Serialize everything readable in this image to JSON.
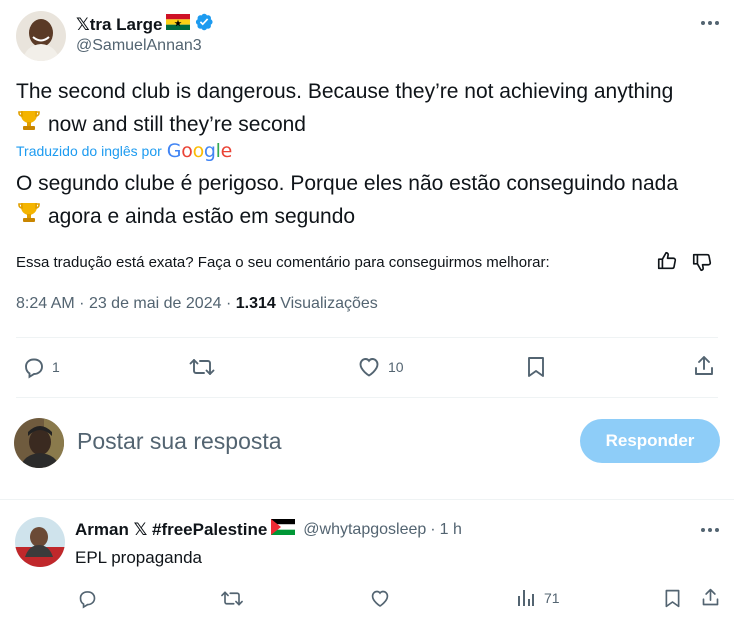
{
  "tweet": {
    "author_name": "𝕏tra Large",
    "author_handle": "@SamuelAnnan3",
    "text_line1": "The second club is dangerous. Because they’re not achieving anything",
    "text_line2": "now and still they’re second",
    "translated_label": "Traduzido do inglês por",
    "google_letters": [
      "G",
      "o",
      "o",
      "g",
      "l",
      "e"
    ],
    "translation_line1": "O segundo clube é perigoso. Porque eles não estão conseguindo nada",
    "translation_line2": "agora e ainda estão em segundo",
    "feedback_prompt": "Essa tradução está exata? Faça o seu comentário para conseguirmos melhorar:",
    "time": "8:24 AM",
    "separator": "·",
    "date": "23 de mai de 2024",
    "views_count": "1.314",
    "views_label": "Visualizações",
    "actions": {
      "reply_count": "1",
      "retweet_count": "",
      "like_count": "10"
    }
  },
  "composer": {
    "placeholder": "Postar sua resposta",
    "button_label": "Responder"
  },
  "reply": {
    "author_name": "Arman 𝕏 #freePalestine",
    "author_handle": "@whytapgosleep",
    "separator": "·",
    "time_ago": "1 h",
    "text": "EPL propaganda",
    "views_count": "71"
  },
  "icons": {
    "verified": "verified-badge-icon",
    "more": "more-dots-icon",
    "trophy": "trophy-emoji",
    "ghana_flag": "ghana-flag-emoji",
    "palestine_flag": "palestine-flag-emoji"
  },
  "colors": {
    "accent": "#1d9bf0",
    "secondary_text": "#536471",
    "button_disabled": "#8ecdf8"
  }
}
